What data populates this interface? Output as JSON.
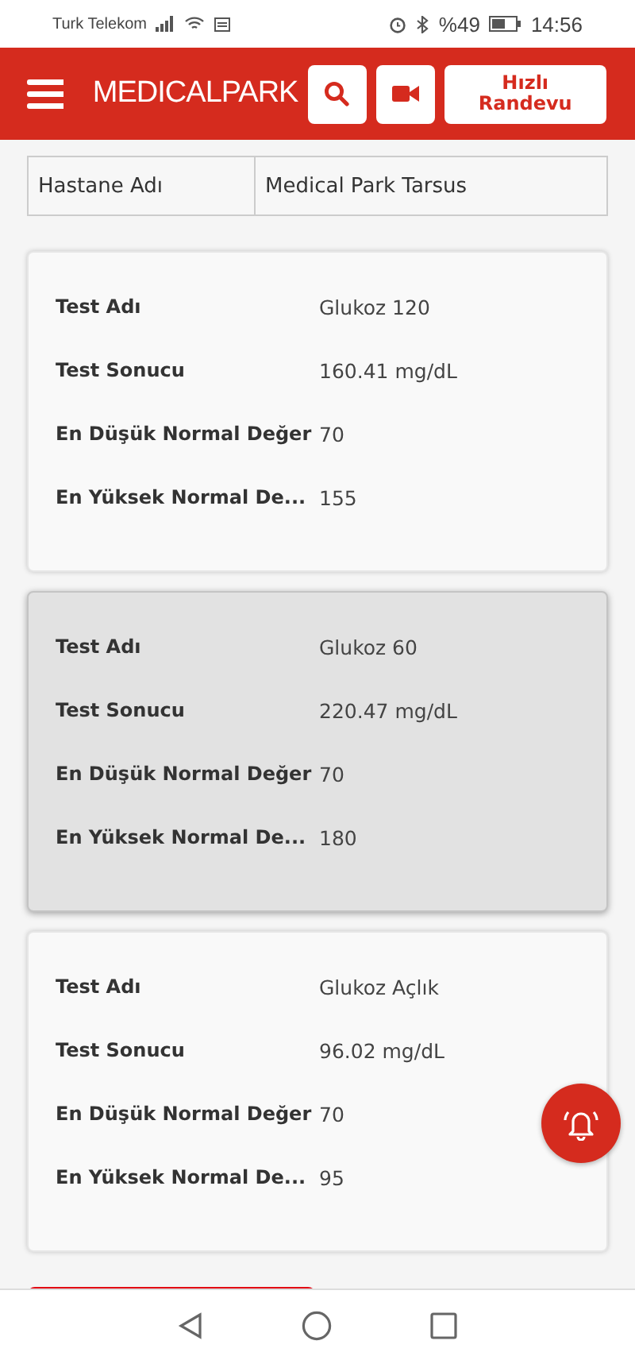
{
  "status_bar": {
    "carrier": "Turk Telekom",
    "battery": "%49",
    "time": "14:56"
  },
  "header": {
    "logo": "MEDICALPARK",
    "quick_button": "Hızlı Randevu"
  },
  "info_table": [
    {
      "label": "Hastane Adı",
      "value": "Medical Park Tarsus"
    }
  ],
  "results": [
    {
      "selected": false,
      "rows": [
        {
          "label": "Test Adı",
          "value": "Glukoz 120"
        },
        {
          "label": "Test Sonucu",
          "value": "160.41 mg/dL"
        },
        {
          "label": "En Düşük Normal Değer",
          "value": "70"
        },
        {
          "label": "En Yüksek Normal De...",
          "value": "155"
        }
      ]
    },
    {
      "selected": true,
      "rows": [
        {
          "label": "Test Adı",
          "value": "Glukoz 60"
        },
        {
          "label": "Test Sonucu",
          "value": "220.47 mg/dL"
        },
        {
          "label": "En Düşük Normal Değer",
          "value": "70"
        },
        {
          "label": "En Yüksek Normal De...",
          "value": "180"
        }
      ]
    },
    {
      "selected": false,
      "rows": [
        {
          "label": "Test Adı",
          "value": "Glukoz Açlık"
        },
        {
          "label": "Test Sonucu",
          "value": "96.02 mg/dL"
        },
        {
          "label": "En Düşük Normal Değer",
          "value": "70"
        },
        {
          "label": "En Yüksek Normal De...",
          "value": "95"
        }
      ]
    }
  ]
}
